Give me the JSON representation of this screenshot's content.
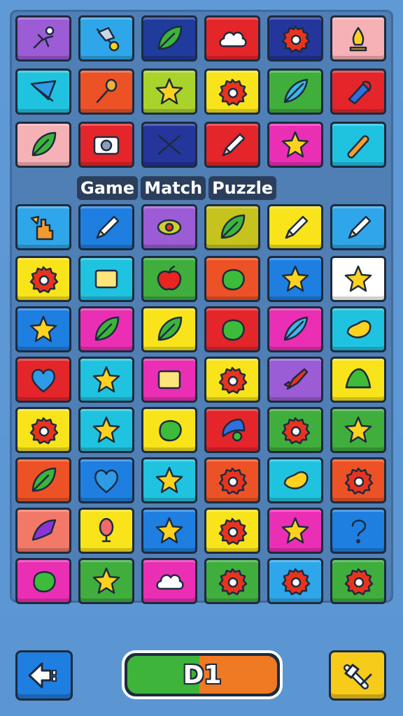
{
  "title": [
    "Game",
    "Match",
    "Puzzle"
  ],
  "level_label": "D1",
  "level_progress": 0.48,
  "buttons": {
    "back": {
      "icon": "back-arrow-icon",
      "color": "#1f7fe0"
    },
    "tool": {
      "icon": "hammer-tool-icon",
      "color": "#f7cb1a"
    }
  },
  "grid": [
    [
      {
        "color": "#9b5cd6",
        "icon": "figure"
      },
      {
        "color": "#2fa6ea",
        "icon": "wand"
      },
      {
        "color": "#1f3b9c",
        "icon": "leaf"
      },
      {
        "color": "#e4262b",
        "icon": "cloud"
      },
      {
        "color": "#24359b",
        "icon": "gear"
      },
      {
        "color": "#f6b1b7",
        "icon": "flame"
      }
    ],
    [
      {
        "color": "#20c3df",
        "icon": "kite"
      },
      {
        "color": "#ec5226",
        "icon": "microphone"
      },
      {
        "color": "#a9d22a",
        "icon": "star"
      },
      {
        "color": "#f9e41c",
        "icon": "gear"
      },
      {
        "color": "#3fae3d",
        "icon": "feather"
      },
      {
        "color": "#e4262b",
        "icon": "marker"
      }
    ],
    [
      {
        "color": "#f6b1b7",
        "icon": "leaf"
      },
      {
        "color": "#e4262b",
        "icon": "camera"
      },
      {
        "color": "#24359b",
        "icon": "cross"
      },
      {
        "color": "#e4262b",
        "icon": "pencil"
      },
      {
        "color": "#ea2fb4",
        "icon": "star"
      },
      {
        "color": "#20c3df",
        "icon": "pill"
      }
    ],
    [
      {
        "color": "#2fa6ea",
        "icon": "hand"
      },
      {
        "color": "#1f7fe0",
        "icon": "pencil"
      },
      {
        "color": "#9b5cd6",
        "icon": "eye"
      },
      {
        "color": "#c6c31e",
        "icon": "leaf"
      },
      {
        "color": "#f9e41c",
        "icon": "pencil"
      },
      {
        "color": "#2fa6ea",
        "icon": "pencil"
      }
    ],
    [
      {
        "color": "#f9e41c",
        "icon": "gear"
      },
      {
        "color": "#20c3df",
        "icon": "square"
      },
      {
        "color": "#3fae3d",
        "icon": "apple"
      },
      {
        "color": "#ec5226",
        "icon": "blob"
      },
      {
        "color": "#1f7fe0",
        "icon": "star"
      },
      {
        "color": "#ffffff",
        "icon": "star"
      }
    ],
    [
      {
        "color": "#1f7fe0",
        "icon": "star"
      },
      {
        "color": "#ea2fb4",
        "icon": "leaf"
      },
      {
        "color": "#f9e41c",
        "icon": "leaf"
      },
      {
        "color": "#e4262b",
        "icon": "blob"
      },
      {
        "color": "#ea2fb4",
        "icon": "feather"
      },
      {
        "color": "#20c3df",
        "icon": "bean"
      }
    ],
    [
      {
        "color": "#e4262b",
        "icon": "heart"
      },
      {
        "color": "#20c3df",
        "icon": "star"
      },
      {
        "color": "#ea2fb4",
        "icon": "square"
      },
      {
        "color": "#f9e41c",
        "icon": "gear"
      },
      {
        "color": "#9b5cd6",
        "icon": "rocket"
      },
      {
        "color": "#f9e41c",
        "icon": "hat"
      }
    ],
    [
      {
        "color": "#f9e41c",
        "icon": "gear"
      },
      {
        "color": "#20c3df",
        "icon": "star"
      },
      {
        "color": "#f9e41c",
        "icon": "blob"
      },
      {
        "color": "#e4262b",
        "icon": "moon"
      },
      {
        "color": "#3fae3d",
        "icon": "gear"
      },
      {
        "color": "#3fae3d",
        "icon": "star"
      }
    ],
    [
      {
        "color": "#ec5226",
        "icon": "leaf"
      },
      {
        "color": "#1f7fe0",
        "icon": "heart"
      },
      {
        "color": "#20c3df",
        "icon": "star"
      },
      {
        "color": "#ec5226",
        "icon": "gear"
      },
      {
        "color": "#20c3df",
        "icon": "bean"
      },
      {
        "color": "#ec5226",
        "icon": "gear"
      }
    ],
    [
      {
        "color": "#f27868",
        "icon": "wing"
      },
      {
        "color": "#f9e41c",
        "icon": "balloon"
      },
      {
        "color": "#1f7fe0",
        "icon": "star"
      },
      {
        "color": "#f9e41c",
        "icon": "gear"
      },
      {
        "color": "#ea2fb4",
        "icon": "star"
      },
      {
        "color": "#1f7fe0",
        "icon": "question"
      }
    ],
    [
      {
        "color": "#ea2fb4",
        "icon": "blob"
      },
      {
        "color": "#3fae3d",
        "icon": "star"
      },
      {
        "color": "#ea2fb4",
        "icon": "cloud"
      },
      {
        "color": "#3fae3d",
        "icon": "gear"
      },
      {
        "color": "#2fa6ea",
        "icon": "gear"
      },
      {
        "color": "#3fae3d",
        "icon": "gear"
      }
    ]
  ]
}
